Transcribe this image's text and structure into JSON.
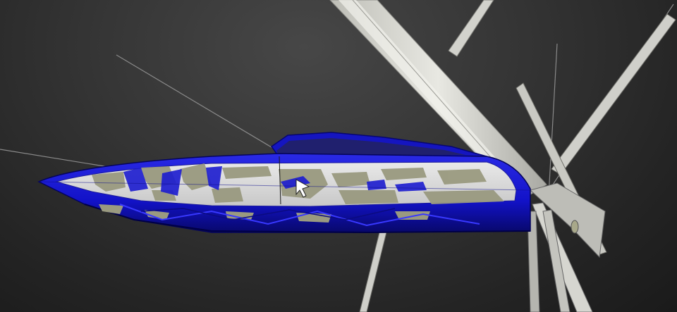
{
  "viewport": {
    "background_top": "#474747",
    "background_bottom": "#1a1a1a"
  },
  "model": {
    "hull_color": "#1a1ad9",
    "hull_dark": "#0a0a8a",
    "deck_color": "#d9d9d9",
    "camo_color": "#9a9a80",
    "mast_color": "#e4e4dc"
  },
  "icons": {
    "cursor": "mouse-pointer-icon"
  }
}
